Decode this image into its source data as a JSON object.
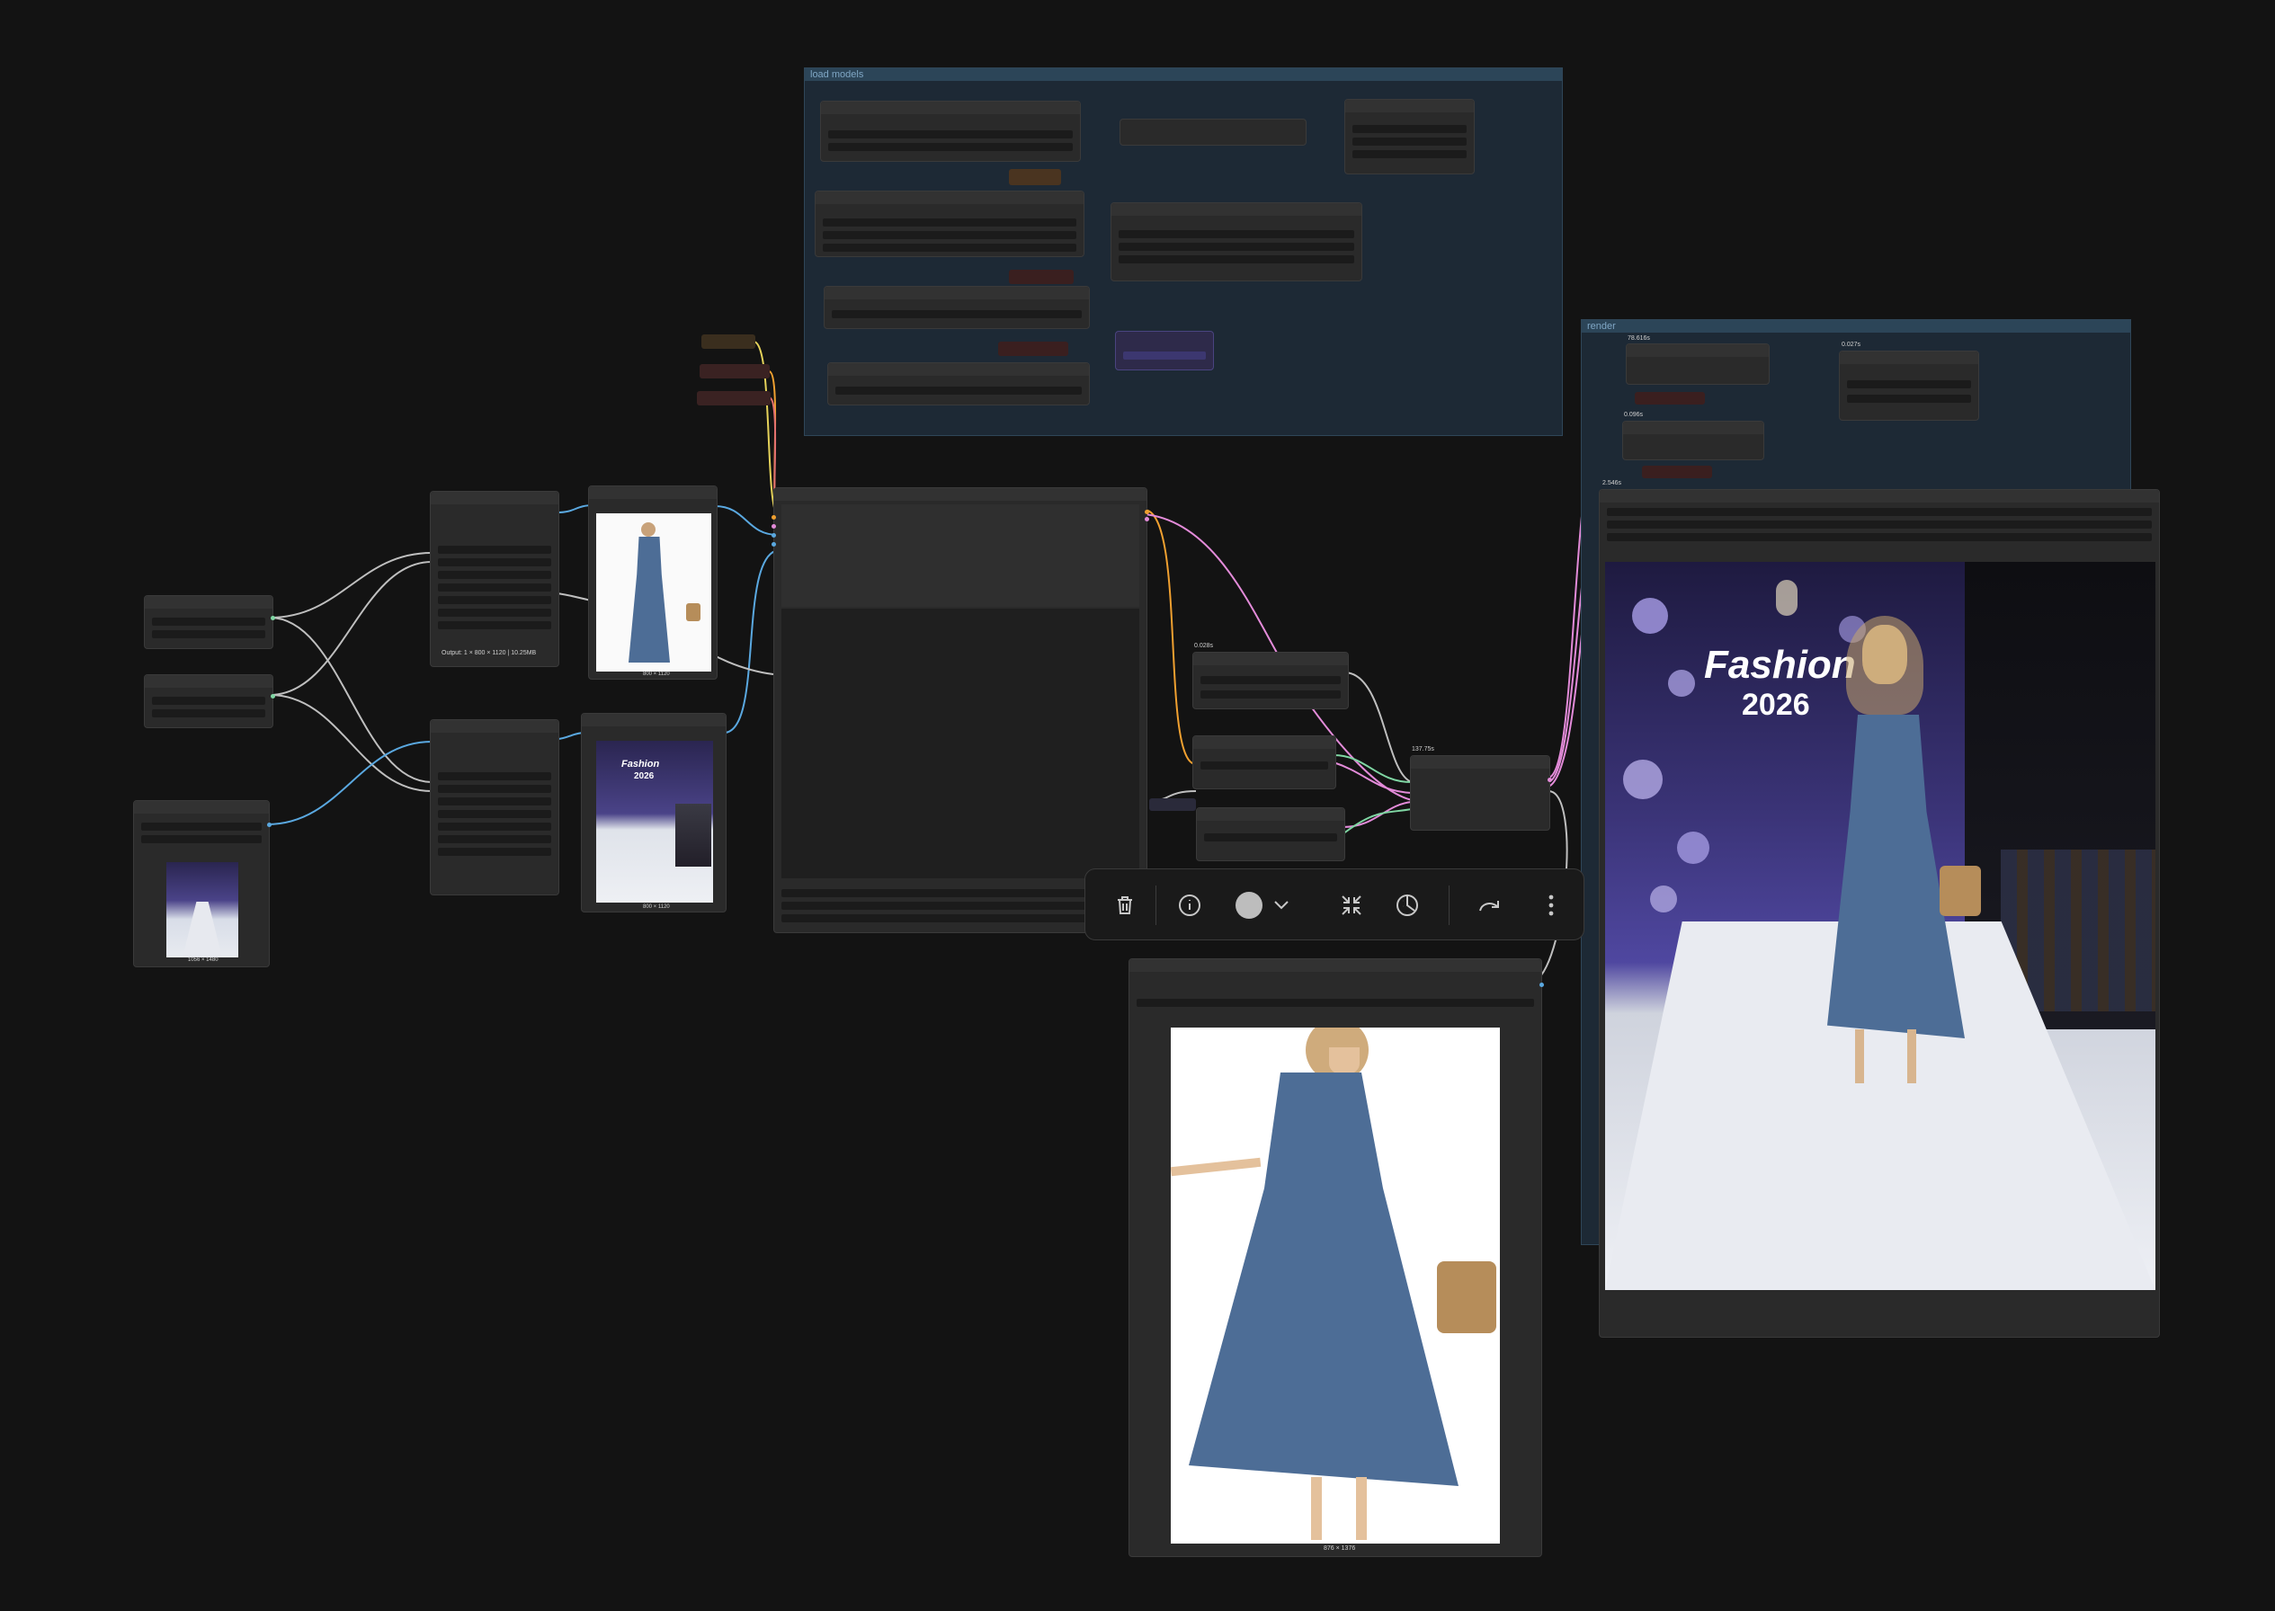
{
  "groups": {
    "load_models": {
      "title": "load models"
    },
    "render": {
      "title": "render"
    }
  },
  "nodes": {
    "image_load_a": {
      "caption": "Output: 1 × 800 × 1120 | 10.25MB"
    },
    "preview_dress": {
      "caption": "800 × 1120"
    },
    "preview_runway": {
      "caption": "800 × 1120"
    },
    "load_runway": {
      "caption": "1056 × 1480"
    },
    "timing_1": {
      "label": "0.028s"
    },
    "timing_2": {
      "label": "137.75s"
    },
    "timing_3": {
      "label": "78.616s"
    },
    "timing_4": {
      "label": "0.027s"
    },
    "timing_5": {
      "label": "0.096s"
    },
    "timing_6": {
      "label": "2.546s"
    },
    "bottom_preview": {
      "caption": "876 × 1376"
    }
  },
  "images": {
    "runway_banner_title": "Fashion",
    "runway_banner_year": "2026"
  },
  "toolbar": {
    "items": [
      "trash-icon",
      "info-icon",
      "color-dot-icon",
      "chevron-down-icon",
      "shrink-icon",
      "palette-icon",
      "redo-icon",
      "more-icon"
    ],
    "color_value": "#bdbdbd"
  },
  "colors": {
    "canvas": "#131313",
    "group_bg": "#1d2935",
    "node_bg": "#2a2a2a",
    "link_blue": "#5aa8e0",
    "link_pink": "#e38bd9",
    "link_orange": "#f0a030",
    "link_white": "#bfbfbf",
    "link_green": "#7fd6a3",
    "link_yellow": "#e5d25a",
    "dress_blue": "#4d6d96"
  }
}
